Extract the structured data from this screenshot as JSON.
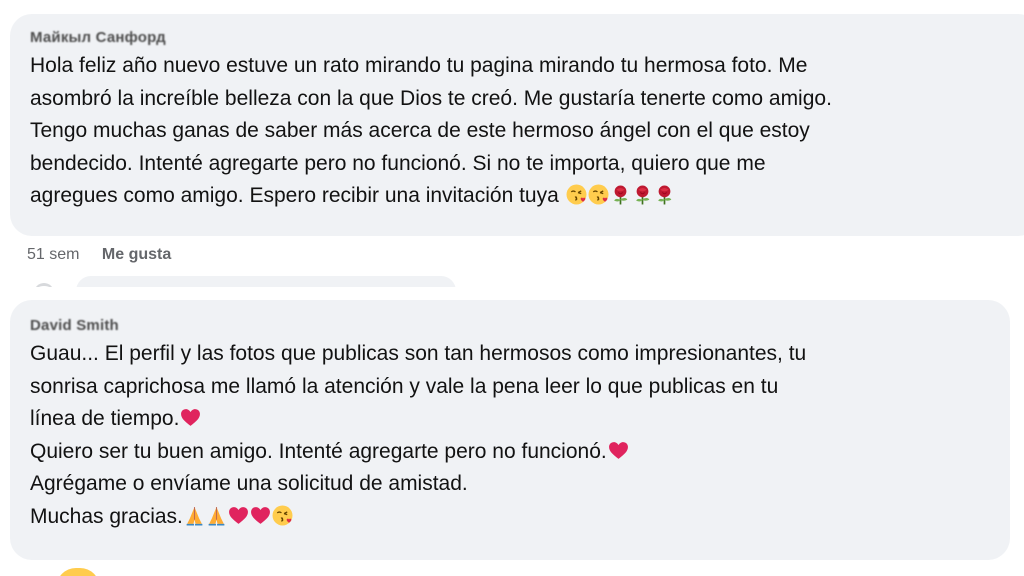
{
  "comments": [
    {
      "author": "Майкыл Санфорд",
      "lines": [
        "Hola feliz año nuevo estuve un rato mirando tu pagina mirando tu hermosa foto. Me",
        "asombró la increíble belleza con la que Dios te creó. Me gustaría tenerte como amigo.",
        "Tengo muchas ganas de saber más acerca de este hermoso ángel con el que estoy",
        "bendecido. Intenté agregarte pero no funcionó. Si no te importa, quiero que me",
        "agregues como amigo. Espero recibir una invitación tuya"
      ],
      "trailing_emojis": [
        "kiss-face",
        "kiss-face",
        "rose",
        "rose",
        "rose"
      ],
      "time": "51 sem",
      "like_label": "Me gusta"
    },
    {
      "author": "David Smith",
      "lines": [
        "Guau... El perfil y las fotos que publicas son tan hermosos como impresionantes, tu",
        "sonrisa caprichosa me llamó la atención y vale la pena leer lo que publicas en tu",
        "línea de tiempo.",
        "Quiero ser tu buen amigo. Intenté agregarte pero no funcionó.",
        "Agrégame o envíame una solicitud de amistad.",
        "Muchas gracias."
      ],
      "line_emojis": [
        [],
        [],
        [
          "heart"
        ],
        [
          "heart"
        ],
        [],
        [
          "pray",
          "pray",
          "heart",
          "heart",
          "kiss-face"
        ]
      ]
    }
  ],
  "colors": {
    "bubble_bg": "#f0f2f5",
    "meta_text": "#65676b",
    "heart": "#e0245e",
    "rose": "#c8102e",
    "emoji_yellow": "#ffcc4d"
  }
}
